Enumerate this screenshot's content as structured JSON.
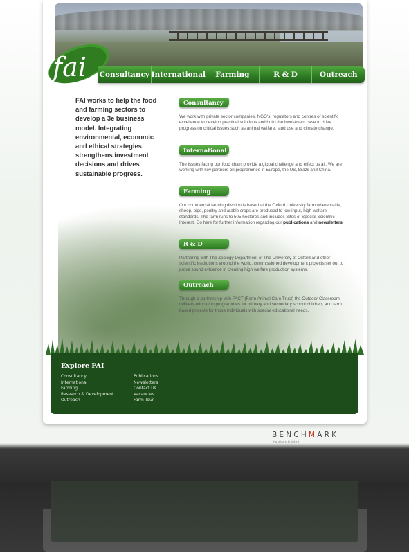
{
  "brand": {
    "logo_text": "fai"
  },
  "nav": {
    "items": [
      {
        "label": "Consultancy"
      },
      {
        "label": "International"
      },
      {
        "label": "Farming"
      },
      {
        "label": "R & D"
      },
      {
        "label": "Outreach"
      }
    ]
  },
  "intro": {
    "text": "FAI works to help the food and farming sectors to develop a 3e business model. Integrating environmental, economic and ethical strategies strengthens investment decisions and drives sustainable progress."
  },
  "sections": [
    {
      "title": "Consultancy",
      "body": "We work with private sector companies, NGO's, regulators and centres of scientific excellence to develop practical solutions and build the investment case to drive progress on critical issues such as animal welfare, land use and climate change."
    },
    {
      "title": "International",
      "body": "The issues facing our food chain provide a global challenge and effect us all. We are working with key partners on programmes in Europe, the US, Brazil and China."
    },
    {
      "title": "Farming",
      "body_prefix": "Our commercial farming division is based at the Oxford University farm where cattle, sheep, pigs, poultry and arable crops are produced to low input, high welfare standards. The farm runs to 505 hectares and includes Sites of Special Scientific Interest. Go here for further information regarding our ",
      "link1": "publications",
      "and": " and ",
      "link2": "newsletters",
      "end": "."
    },
    {
      "title": "R & D",
      "body": "Partnering with The Zoology Department of The University of Oxford and other scientific institutions around the world, commissioned development projects set out to prove sound evidence in creating high welfare production systems."
    },
    {
      "title": "Outreach",
      "body": "Through a partnership with FACT (Farm Animal Care Trust) the Outdoor Classroom delivers education programmes for primary and secondary school children, and farm based projects for those individuals with special educational needs."
    }
  ],
  "footer": {
    "title": "Explore FAI",
    "col1": [
      "Consultancy",
      "International",
      "Farming",
      "Research & Development",
      "Outreach"
    ],
    "col2": [
      "Publications",
      "Newsletters",
      "Contact Us",
      "Vacancies",
      "Farm Tour"
    ]
  },
  "benchmark": {
    "left": "BENCH",
    "mark": "M",
    "right": "ARK",
    "sub": "Holdings Limited"
  },
  "colors": {
    "nav_green": "#2d7a23",
    "footer_green": "#1e4d1c",
    "benchmark_red": "#c0301c"
  }
}
